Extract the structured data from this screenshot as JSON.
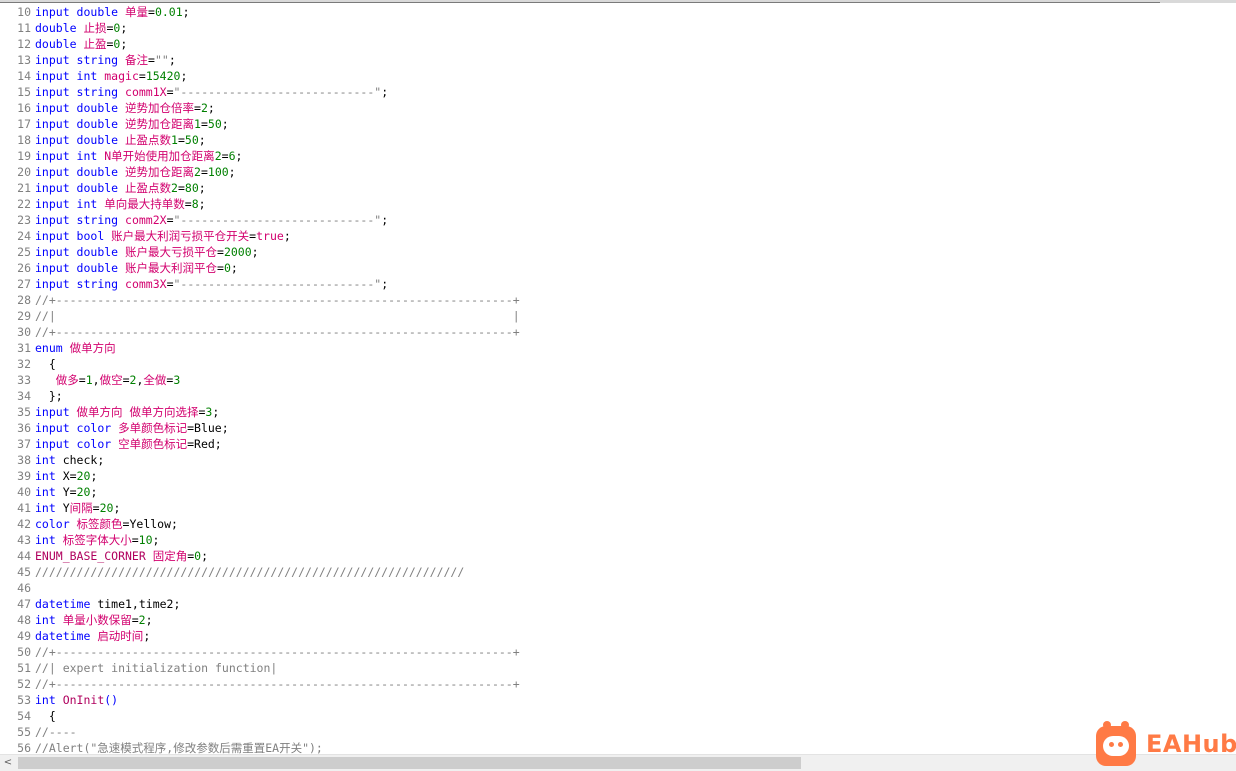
{
  "editor": {
    "lines": [
      {
        "n": "10",
        "t": [
          [
            "kw",
            "input "
          ],
          [
            "kw",
            "double "
          ],
          [
            "zh",
            "单量"
          ],
          [
            "pun",
            "="
          ],
          [
            "num",
            "0.01"
          ],
          [
            "pun",
            ";"
          ]
        ]
      },
      {
        "n": "11",
        "t": [
          [
            "kw",
            "double "
          ],
          [
            "zh",
            "止损"
          ],
          [
            "pun",
            "="
          ],
          [
            "num",
            "0"
          ],
          [
            "pun",
            ";"
          ]
        ]
      },
      {
        "n": "12",
        "t": [
          [
            "kw",
            "double "
          ],
          [
            "zh",
            "止盈"
          ],
          [
            "pun",
            "="
          ],
          [
            "num",
            "0"
          ],
          [
            "pun",
            ";"
          ]
        ]
      },
      {
        "n": "13",
        "t": [
          [
            "kw",
            "input "
          ],
          [
            "kw",
            "string "
          ],
          [
            "zh",
            "备注"
          ],
          [
            "pun",
            "="
          ],
          [
            "str",
            "\"\""
          ],
          [
            "pun",
            ";"
          ]
        ]
      },
      {
        "n": "14",
        "t": [
          [
            "kw",
            "input "
          ],
          [
            "kw",
            "int "
          ],
          [
            "zh",
            "magic"
          ],
          [
            "pun",
            "="
          ],
          [
            "num",
            "15420"
          ],
          [
            "pun",
            ";"
          ]
        ]
      },
      {
        "n": "15",
        "t": [
          [
            "kw",
            "input "
          ],
          [
            "kw",
            "string "
          ],
          [
            "zh",
            "comm1X"
          ],
          [
            "pun",
            "="
          ],
          [
            "str",
            "\"----------------------------\""
          ],
          [
            "pun",
            ";"
          ]
        ]
      },
      {
        "n": "16",
        "t": [
          [
            "kw",
            "input "
          ],
          [
            "kw",
            "double "
          ],
          [
            "zh",
            "逆势加仓倍率"
          ],
          [
            "pun",
            "="
          ],
          [
            "num",
            "2"
          ],
          [
            "pun",
            ";"
          ]
        ]
      },
      {
        "n": "17",
        "t": [
          [
            "kw",
            "input "
          ],
          [
            "kw",
            "double "
          ],
          [
            "zh",
            "逆势加仓距离"
          ],
          [
            "num",
            "1"
          ],
          [
            "pun",
            "="
          ],
          [
            "num",
            "50"
          ],
          [
            "pun",
            ";"
          ]
        ]
      },
      {
        "n": "18",
        "t": [
          [
            "kw",
            "input "
          ],
          [
            "kw",
            "double "
          ],
          [
            "zh",
            "止盈点数"
          ],
          [
            "num",
            "1"
          ],
          [
            "pun",
            "="
          ],
          [
            "num",
            "50"
          ],
          [
            "pun",
            ";"
          ]
        ]
      },
      {
        "n": "19",
        "t": [
          [
            "kw",
            "input "
          ],
          [
            "kw",
            "int "
          ],
          [
            "zh",
            "N单开始使用加仓距离"
          ],
          [
            "num",
            "2"
          ],
          [
            "pun",
            "="
          ],
          [
            "num",
            "6"
          ],
          [
            "pun",
            ";"
          ]
        ]
      },
      {
        "n": "20",
        "t": [
          [
            "kw",
            "input "
          ],
          [
            "kw",
            "double "
          ],
          [
            "zh",
            "逆势加仓距离"
          ],
          [
            "num",
            "2"
          ],
          [
            "pun",
            "="
          ],
          [
            "num",
            "100"
          ],
          [
            "pun",
            ";"
          ]
        ]
      },
      {
        "n": "21",
        "t": [
          [
            "kw",
            "input "
          ],
          [
            "kw",
            "double "
          ],
          [
            "zh",
            "止盈点数"
          ],
          [
            "num",
            "2"
          ],
          [
            "pun",
            "="
          ],
          [
            "num",
            "80"
          ],
          [
            "pun",
            ";"
          ]
        ]
      },
      {
        "n": "22",
        "t": [
          [
            "kw",
            "input "
          ],
          [
            "kw",
            "int "
          ],
          [
            "zh",
            "单向最大持单数"
          ],
          [
            "pun",
            "="
          ],
          [
            "num",
            "8"
          ],
          [
            "pun",
            ";"
          ]
        ]
      },
      {
        "n": "23",
        "t": [
          [
            "kw",
            "input "
          ],
          [
            "kw",
            "string "
          ],
          [
            "zh",
            "comm2X"
          ],
          [
            "pun",
            "="
          ],
          [
            "str",
            "\"----------------------------\""
          ],
          [
            "pun",
            ";"
          ]
        ]
      },
      {
        "n": "24",
        "t": [
          [
            "kw",
            "input "
          ],
          [
            "kw",
            "bool "
          ],
          [
            "zh",
            "账户最大利润亏损平仓开关"
          ],
          [
            "pun",
            "="
          ],
          [
            "tr",
            "true"
          ],
          [
            "pun",
            ";"
          ]
        ]
      },
      {
        "n": "25",
        "t": [
          [
            "kw",
            "input "
          ],
          [
            "kw",
            "double "
          ],
          [
            "zh",
            "账户最大亏损平仓"
          ],
          [
            "pun",
            "="
          ],
          [
            "num",
            "2000"
          ],
          [
            "pun",
            ";"
          ]
        ]
      },
      {
        "n": "26",
        "t": [
          [
            "kw",
            "input "
          ],
          [
            "kw",
            "double "
          ],
          [
            "zh",
            "账户最大利润平仓"
          ],
          [
            "pun",
            "="
          ],
          [
            "num",
            "0"
          ],
          [
            "pun",
            ";"
          ]
        ]
      },
      {
        "n": "27",
        "t": [
          [
            "kw",
            "input "
          ],
          [
            "kw",
            "string "
          ],
          [
            "zh",
            "comm3X"
          ],
          [
            "pun",
            "="
          ],
          [
            "str",
            "\"----------------------------\""
          ],
          [
            "pun",
            ";"
          ]
        ]
      },
      {
        "n": "28",
        "t": [
          [
            "cmt",
            "//+------------------------------------------------------------------+"
          ]
        ]
      },
      {
        "n": "29",
        "t": [
          [
            "cmt",
            "//|                                                                  |"
          ]
        ]
      },
      {
        "n": "30",
        "t": [
          [
            "cmt",
            "//+------------------------------------------------------------------+"
          ]
        ]
      },
      {
        "n": "31",
        "t": [
          [
            "kw",
            "enum "
          ],
          [
            "zh",
            "做单方向"
          ]
        ]
      },
      {
        "n": "32",
        "t": [
          [
            "pun",
            "  {"
          ]
        ]
      },
      {
        "n": "33",
        "t": [
          [
            "pun",
            "   "
          ],
          [
            "zh",
            "做多"
          ],
          [
            "pun",
            "="
          ],
          [
            "num",
            "1"
          ],
          [
            "pun",
            ","
          ],
          [
            "zh",
            "做空"
          ],
          [
            "pun",
            "="
          ],
          [
            "num",
            "2"
          ],
          [
            "pun",
            ","
          ],
          [
            "zh",
            "全做"
          ],
          [
            "pun",
            "="
          ],
          [
            "num",
            "3"
          ]
        ]
      },
      {
        "n": "34",
        "t": [
          [
            "pun",
            "  };"
          ]
        ]
      },
      {
        "n": "35",
        "t": [
          [
            "kw",
            "input "
          ],
          [
            "zh",
            "做单方向 做单方向选择"
          ],
          [
            "pun",
            "="
          ],
          [
            "num",
            "3"
          ],
          [
            "pun",
            ";"
          ]
        ]
      },
      {
        "n": "36",
        "t": [
          [
            "kw",
            "input "
          ],
          [
            "kw",
            "color "
          ],
          [
            "zh",
            "多单颜色标记"
          ],
          [
            "pun",
            "=Blue;"
          ]
        ]
      },
      {
        "n": "37",
        "t": [
          [
            "kw",
            "input "
          ],
          [
            "kw",
            "color "
          ],
          [
            "zh",
            "空单颜色标记"
          ],
          [
            "pun",
            "=Red;"
          ]
        ]
      },
      {
        "n": "38",
        "t": [
          [
            "kw",
            "int "
          ],
          [
            "id",
            "check;"
          ]
        ]
      },
      {
        "n": "39",
        "t": [
          [
            "kw",
            "int "
          ],
          [
            "id",
            "X"
          ],
          [
            "pun",
            "="
          ],
          [
            "num",
            "20"
          ],
          [
            "pun",
            ";"
          ]
        ]
      },
      {
        "n": "40",
        "t": [
          [
            "kw",
            "int "
          ],
          [
            "id",
            "Y"
          ],
          [
            "pun",
            "="
          ],
          [
            "num",
            "20"
          ],
          [
            "pun",
            ";"
          ]
        ]
      },
      {
        "n": "41",
        "t": [
          [
            "kw",
            "int "
          ],
          [
            "id",
            "Y"
          ],
          [
            "zh",
            "间隔"
          ],
          [
            "pun",
            "="
          ],
          [
            "num",
            "20"
          ],
          [
            "pun",
            ";"
          ]
        ]
      },
      {
        "n": "42",
        "t": [
          [
            "kw",
            "color "
          ],
          [
            "zh",
            "标签颜色"
          ],
          [
            "pun",
            "=Yellow;"
          ]
        ]
      },
      {
        "n": "43",
        "t": [
          [
            "kw",
            "int "
          ],
          [
            "zh",
            "标签字体大小"
          ],
          [
            "pun",
            "="
          ],
          [
            "num",
            "10"
          ],
          [
            "pun",
            ";"
          ]
        ]
      },
      {
        "n": "44",
        "t": [
          [
            "fn",
            "ENUM_BASE_CORNER "
          ],
          [
            "zh",
            "固定角"
          ],
          [
            "pun",
            "="
          ],
          [
            "num",
            "0"
          ],
          [
            "pun",
            ";"
          ]
        ]
      },
      {
        "n": "45",
        "t": [
          [
            "cmt",
            "//////////////////////////////////////////////////////////////"
          ]
        ]
      },
      {
        "n": "46",
        "t": []
      },
      {
        "n": "47",
        "t": [
          [
            "kw",
            "datetime "
          ],
          [
            "id",
            "time1,time2;"
          ]
        ]
      },
      {
        "n": "48",
        "t": [
          [
            "kw",
            "int "
          ],
          [
            "zh",
            "单量小数保留"
          ],
          [
            "pun",
            "="
          ],
          [
            "num",
            "2"
          ],
          [
            "pun",
            ";"
          ]
        ]
      },
      {
        "n": "49",
        "t": [
          [
            "kw",
            "datetime "
          ],
          [
            "zh",
            "启动时间"
          ],
          [
            "pun",
            ";"
          ]
        ]
      },
      {
        "n": "50",
        "t": [
          [
            "cmt",
            "//+------------------------------------------------------------------+"
          ]
        ]
      },
      {
        "n": "51",
        "t": [
          [
            "cmt",
            "//| expert initialization function|"
          ]
        ]
      },
      {
        "n": "52",
        "t": [
          [
            "cmt",
            "//+------------------------------------------------------------------+"
          ]
        ]
      },
      {
        "n": "53",
        "t": [
          [
            "kw",
            "int "
          ],
          [
            "fn",
            "OnInit"
          ],
          [
            "kw",
            "()"
          ]
        ]
      },
      {
        "n": "54",
        "t": [
          [
            "pun",
            "  {"
          ]
        ]
      },
      {
        "n": "55",
        "t": [
          [
            "cmt",
            "//----"
          ]
        ]
      },
      {
        "n": "56",
        "t": [
          [
            "cmt",
            "//Alert(\"急速模式程序,修改参数后需重置EA开关\");"
          ]
        ]
      }
    ]
  },
  "watermark": {
    "text": "EAHub",
    "color": "#ff7a45"
  },
  "scrollbar": {
    "left_arrow": "<"
  }
}
